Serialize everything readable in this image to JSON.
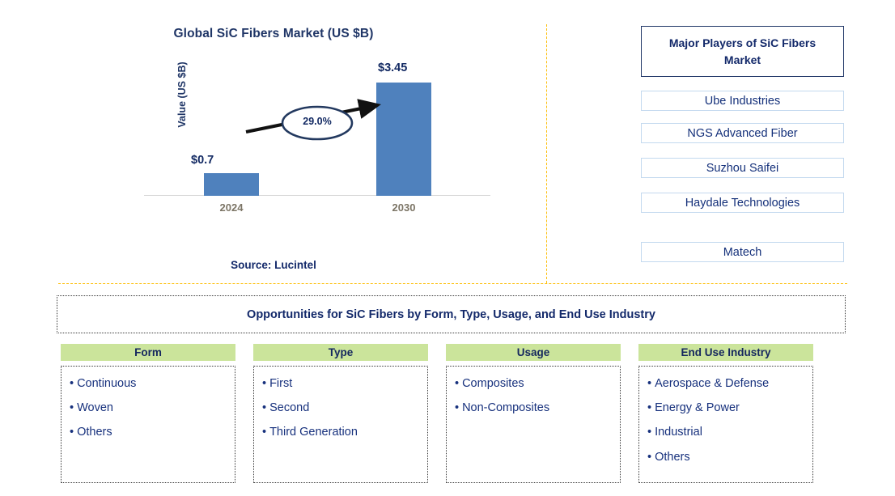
{
  "chart_data": {
    "type": "bar",
    "title": "Global SiC Fibers Market (US $B)",
    "xlabel": "",
    "ylabel": "Value (US $B)",
    "categories": [
      "2024",
      "2030"
    ],
    "values": [
      0.7,
      3.45
    ],
    "value_labels": [
      "$0.7",
      "$3.45"
    ],
    "ylim": [
      0,
      4.0
    ],
    "grid": false,
    "legend": "none",
    "bar_color": "#4f81bd",
    "annotations": [
      {
        "name": "cagr-ellipse",
        "text": "29.0%",
        "kind": "growth-rate-callout"
      }
    ],
    "source": "Source: Lucintel"
  },
  "chart_panel": {
    "title": "Global SiC Fibers Market (US $B)",
    "y_axis_label": "Value (US $B)",
    "bars": [
      {
        "category": "2024",
        "label": "$0.7",
        "value": 0.7
      },
      {
        "category": "2030",
        "label": "$3.45",
        "value": 3.45
      }
    ],
    "cagr_label": "29.0%",
    "source": "Source: Lucintel"
  },
  "players_panel": {
    "header": "Major Players of SiC Fibers Market",
    "items": [
      {
        "name": "Ube Industries"
      },
      {
        "name": "NGS Advanced Fiber"
      },
      {
        "name": "Suzhou Saifei"
      },
      {
        "name": "Haydale Technologies"
      },
      {
        "name": "Matech"
      }
    ]
  },
  "opportunities": {
    "banner": "Opportunities for SiC Fibers by Form, Type, Usage, and End Use Industry",
    "columns": [
      {
        "header": "Form",
        "items": [
          "Continuous",
          "Woven",
          "Others"
        ]
      },
      {
        "header": "Type",
        "items": [
          "First",
          "Second",
          "Third Generation"
        ]
      },
      {
        "header": "Usage",
        "items": [
          "Composites",
          "Non-Composites"
        ]
      },
      {
        "header": "End Use Industry",
        "items": [
          "Aerospace & Defense",
          "Energy & Power",
          "Industrial",
          "Others"
        ]
      }
    ]
  },
  "colors": {
    "bar": "#4f81bd",
    "navy_text": "#13296a",
    "green_header": "#cbe49b",
    "gold_divider": "#fdc010",
    "light_blue_border": "#c3d9ef"
  },
  "bullet_glyph": "•"
}
